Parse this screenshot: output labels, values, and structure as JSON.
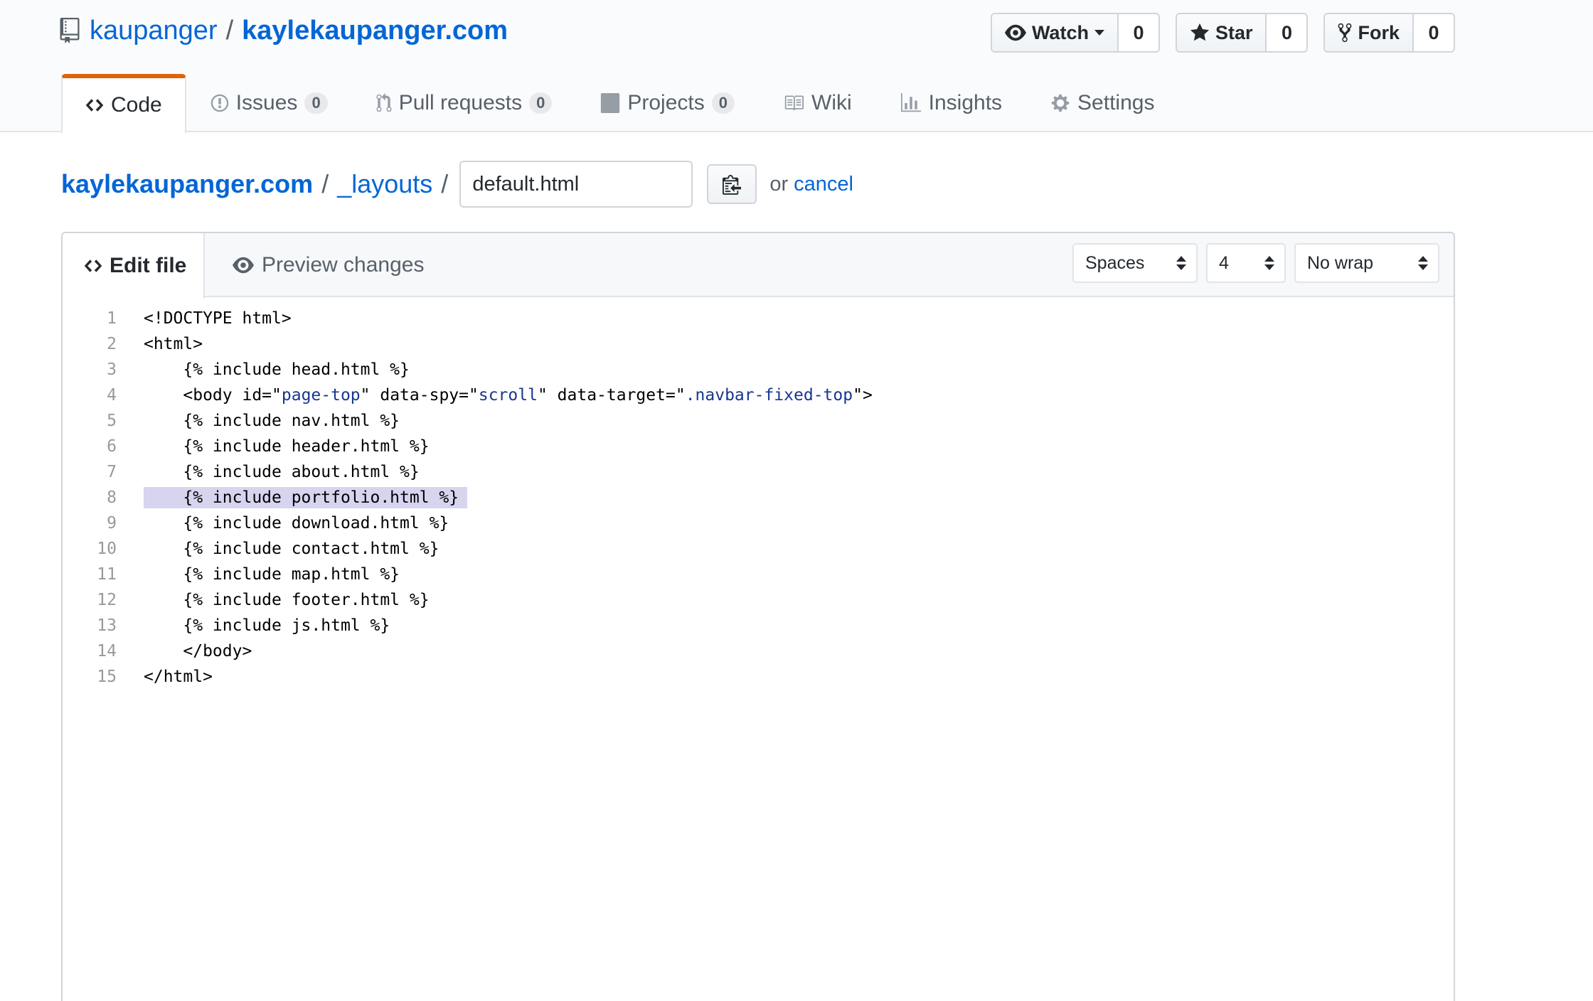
{
  "repo": {
    "owner": "kaupanger",
    "separator": "/",
    "name": "kaylekaupanger.com"
  },
  "actions": {
    "watch": {
      "label": "Watch",
      "count": "0"
    },
    "star": {
      "label": "Star",
      "count": "0"
    },
    "fork": {
      "label": "Fork",
      "count": "0"
    }
  },
  "nav": {
    "code": {
      "label": "Code"
    },
    "issues": {
      "label": "Issues",
      "count": "0"
    },
    "pulls": {
      "label": "Pull requests",
      "count": "0"
    },
    "projects": {
      "label": "Projects",
      "count": "0"
    },
    "wiki": {
      "label": "Wiki"
    },
    "insights": {
      "label": "Insights"
    },
    "settings": {
      "label": "Settings"
    }
  },
  "breadcrumb": {
    "root": "kaylekaupanger.com",
    "folder": "_layouts",
    "separator": "/",
    "filename": "default.html",
    "or_text": "or",
    "cancel": "cancel"
  },
  "editor": {
    "edit_tab": "Edit file",
    "preview_tab": "Preview changes",
    "indent_mode": "Spaces",
    "indent_size": "4",
    "wrap_mode": "No wrap",
    "highlighted_line": 8,
    "lines": [
      {
        "num": "1",
        "text": "<!DOCTYPE html>"
      },
      {
        "num": "2",
        "text": "<html>"
      },
      {
        "num": "3",
        "text": "    {% include head.html %}"
      },
      {
        "num": "4",
        "text": "    <body id=\"page-top\" data-spy=\"scroll\" data-target=\".navbar-fixed-top\">"
      },
      {
        "num": "5",
        "text": "    {% include nav.html %}"
      },
      {
        "num": "6",
        "text": "    {% include header.html %}"
      },
      {
        "num": "7",
        "text": "    {% include about.html %}"
      },
      {
        "num": "8",
        "text": "    {% include portfolio.html %}"
      },
      {
        "num": "9",
        "text": "    {% include download.html %}"
      },
      {
        "num": "10",
        "text": "    {% include contact.html %}"
      },
      {
        "num": "11",
        "text": "    {% include map.html %}"
      },
      {
        "num": "12",
        "text": "    {% include footer.html %}"
      },
      {
        "num": "13",
        "text": "    {% include js.html %}"
      },
      {
        "num": "14",
        "text": "    </body>"
      },
      {
        "num": "15",
        "text": "</html>"
      }
    ]
  },
  "colors": {
    "link": "#0366d6",
    "active_tab_accent": "#e36209",
    "line_highlight": "#d7d4f0",
    "string": "#183691"
  }
}
